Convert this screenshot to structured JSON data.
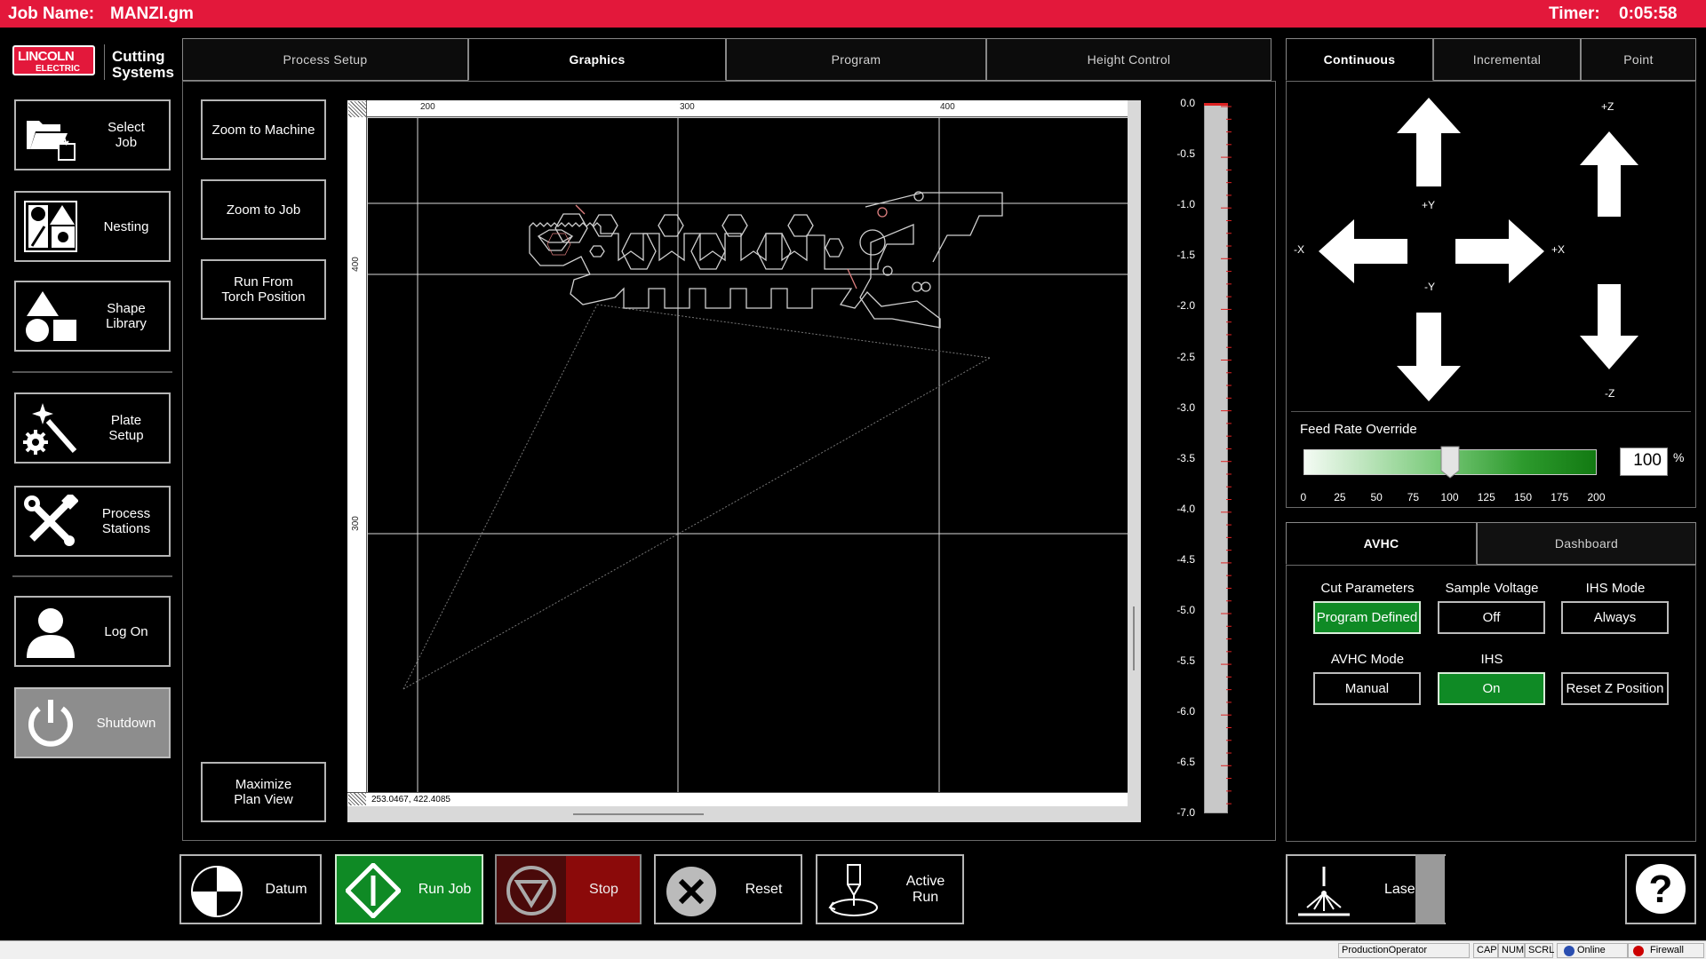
{
  "header": {
    "job_label": "Job Name:",
    "job_name": "MANZI.gm",
    "timer_label": "Timer:",
    "timer_value": "0:05:58"
  },
  "logo": {
    "brand_line1": "LINCOLN",
    "brand_line2": "ELECTRIC",
    "product": "Cutting\nSystems"
  },
  "nav": {
    "select_job": "Select\nJob",
    "nesting": "Nesting",
    "shape_library": "Shape\nLibrary",
    "plate_setup": "Plate\nSetup",
    "process_stations": "Process\nStations",
    "log_on": "Log On",
    "shutdown": "Shutdown"
  },
  "main_tabs": [
    "Process Setup",
    "Graphics",
    "Program",
    "Height Control"
  ],
  "graphics_buttons": {
    "zoom_machine": "Zoom to Machine",
    "zoom_job": "Zoom to Job",
    "run_from_torch": "Run From\nTorch Position",
    "maximize": "Maximize\nPlan View"
  },
  "plot": {
    "x_ticks": [
      "200",
      "300",
      "400"
    ],
    "y_ticks": [
      "400",
      "300"
    ],
    "cursor_coords": "253.0467, 422.4085"
  },
  "z_gauge": {
    "labels": [
      "0.0",
      "-0.5",
      "-1.0",
      "-1.5",
      "-2.0",
      "-2.5",
      "-3.0",
      "-3.5",
      "-4.0",
      "-4.5",
      "-5.0",
      "-5.5",
      "-6.0",
      "-6.5",
      "-7.0"
    ],
    "indicator_color": "#dd2222"
  },
  "jog": {
    "tabs": [
      "Continuous",
      "Incremental",
      "Point"
    ],
    "plus_y": "+Y",
    "minus_y": "-Y",
    "minus_x": "-X",
    "plus_x": "+X",
    "plus_z": "+Z",
    "minus_z": "-Z"
  },
  "feed_rate": {
    "label": "Feed Rate Override",
    "value": "100",
    "unit": "%",
    "level": 100,
    "min": 0,
    "max": 200,
    "ticks": [
      "0",
      "25",
      "50",
      "75",
      "100",
      "125",
      "150",
      "175",
      "200"
    ]
  },
  "avhc": {
    "tabs": [
      "AVHC",
      "Dashboard"
    ],
    "cut_params_label": "Cut Parameters",
    "cut_params_value": "Program Defined",
    "sample_voltage_label": "Sample Voltage",
    "sample_voltage_value": "Off",
    "ihs_mode_label": "IHS Mode",
    "ihs_mode_value": "Always",
    "avhc_mode_label": "AVHC Mode",
    "avhc_mode_value": "Manual",
    "ihs_label": "IHS",
    "ihs_value": "On",
    "reset_z": "Reset Z Position",
    "on_color": "#0f8a25"
  },
  "bottom": {
    "datum": "Datum",
    "run_job": "Run Job",
    "stop": "Stop",
    "reset": "Reset",
    "active_run": "Active\nRun",
    "laser": "Laser",
    "help": "?"
  },
  "statusbar": {
    "user": "ProductionOperator",
    "cap": "CAP",
    "num": "NUM",
    "scrl": "SCRL",
    "online": "Online",
    "firewall": "Firewall"
  },
  "colors": {
    "accent_red": "#e3183b",
    "run_green": "#0f8a25",
    "stop_red": "#8b0a0a"
  }
}
